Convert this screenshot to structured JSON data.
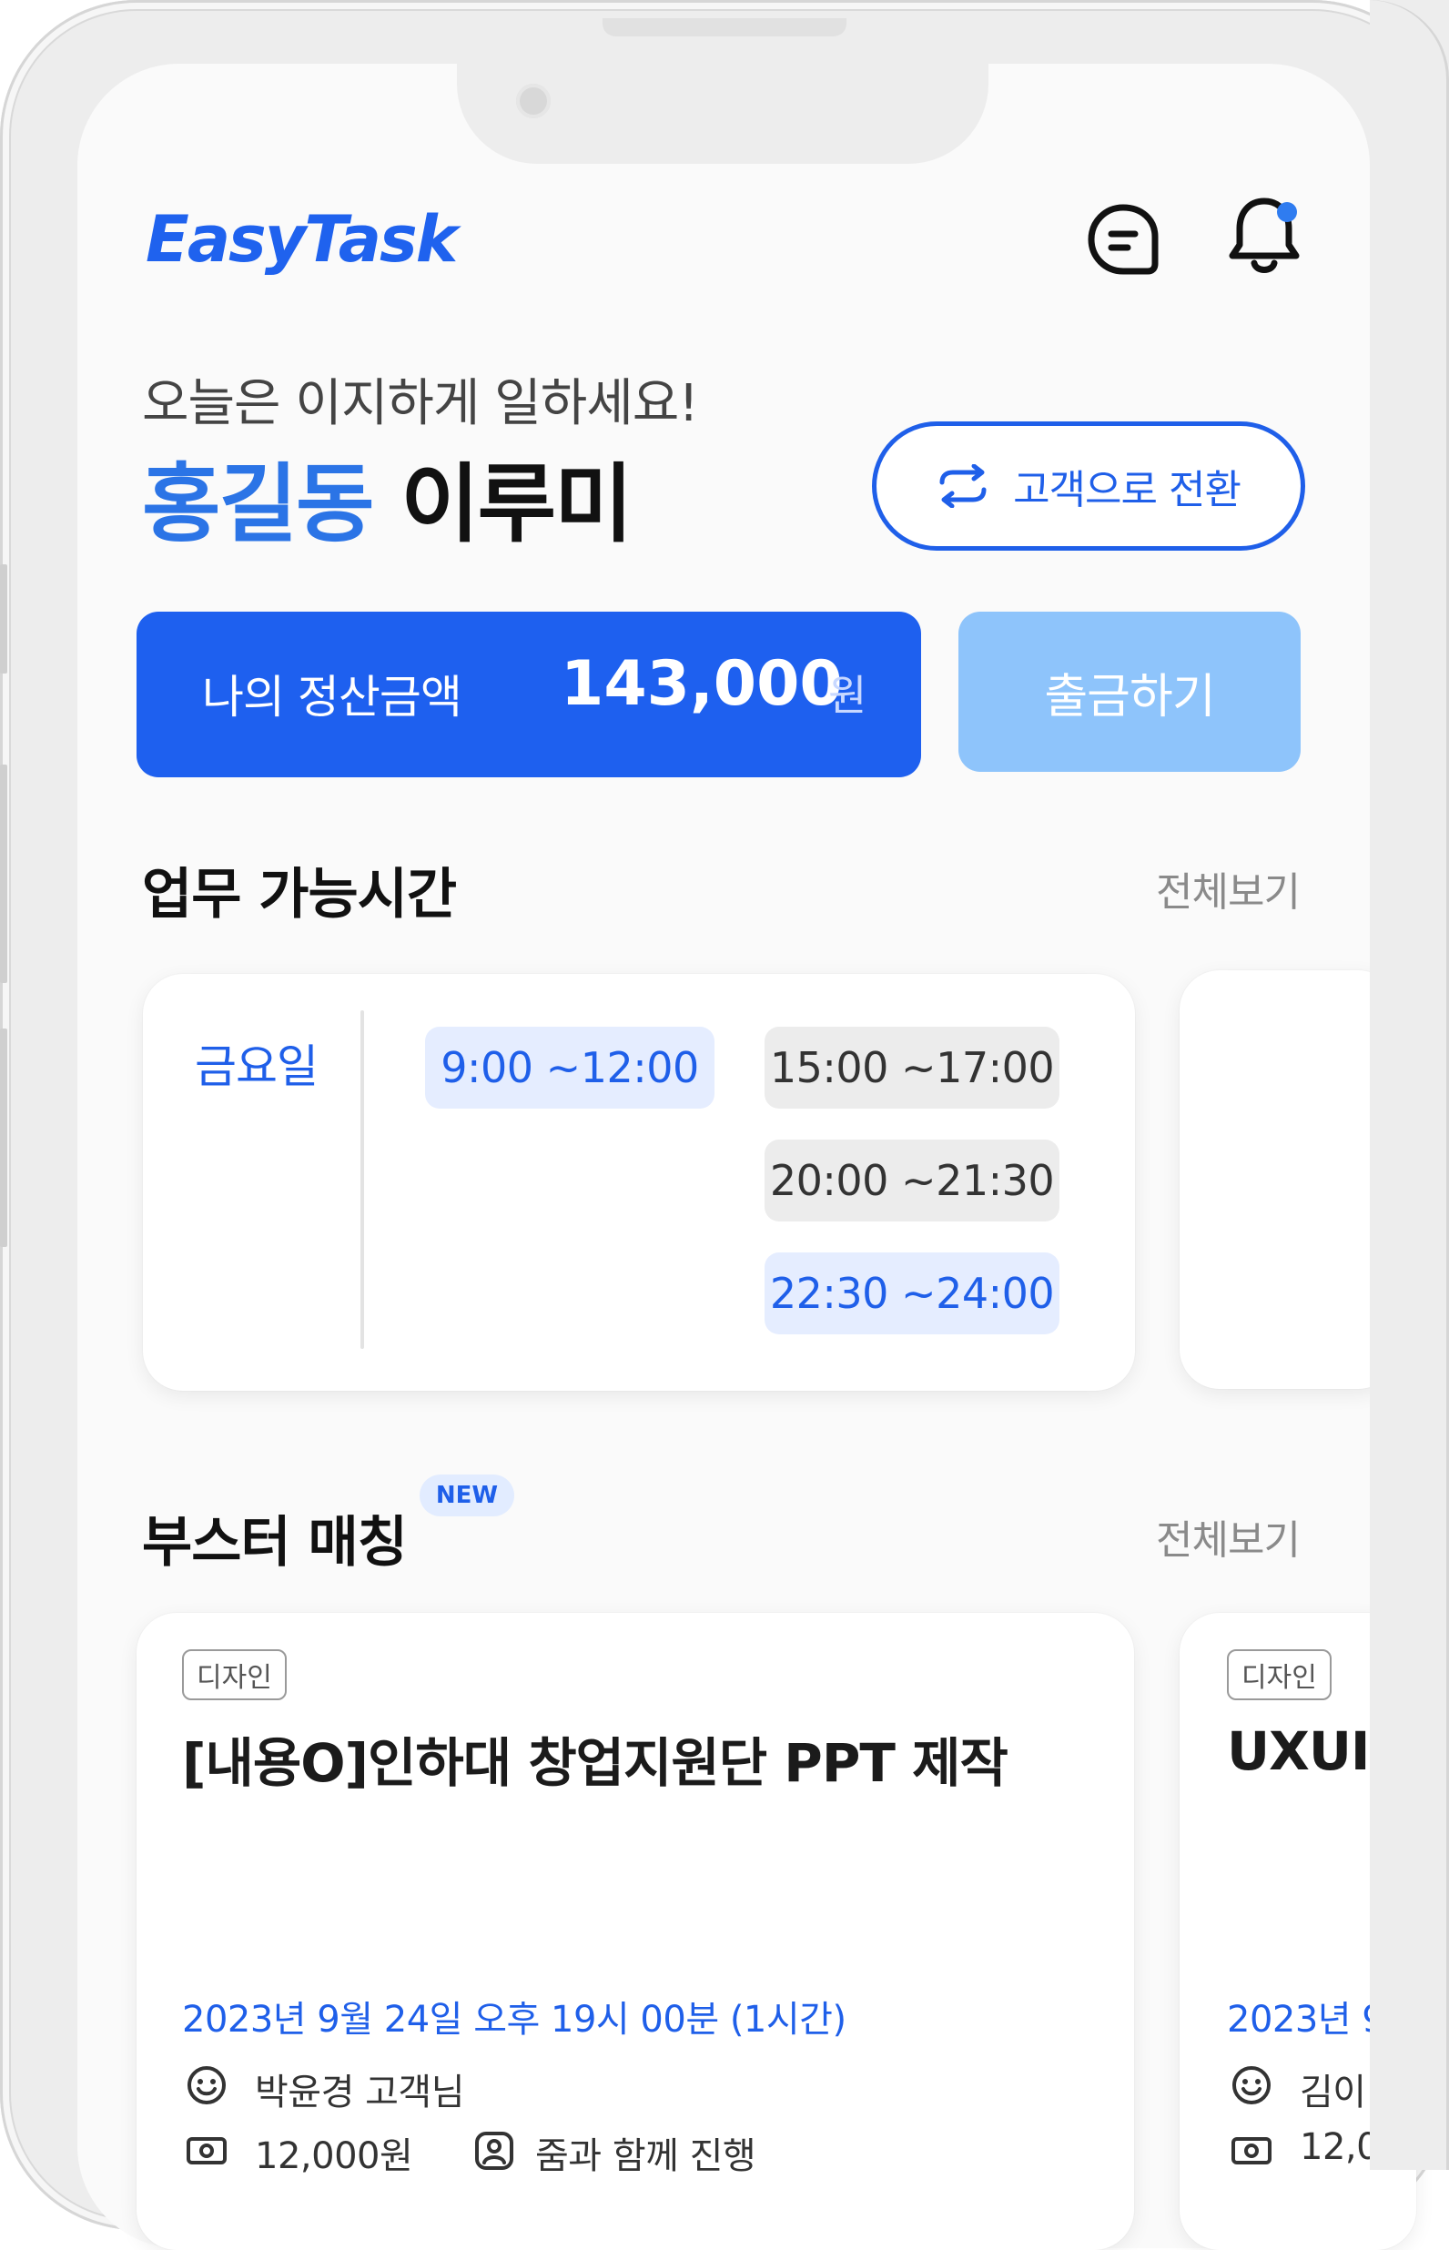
{
  "app": {
    "logo": "EasyTask"
  },
  "header": {
    "greeting": "오늘은 이지하게 일하세요!",
    "name_brand": "홍길동",
    "name_person": "이루미",
    "switch_label": "고객으로 전환"
  },
  "balance": {
    "label": "나의 정산금액",
    "amount": "143,000",
    "unit": "원",
    "withdraw_label": "출금하기"
  },
  "availability": {
    "title": "업무 가능시간",
    "view_all": "전체보기",
    "day": "금요일",
    "slots": [
      {
        "time": "9:00 ~12:00",
        "state": "selected"
      },
      {
        "time": "15:00 ~17:00",
        "state": "default"
      },
      {
        "time": "20:00 ~21:30",
        "state": "default"
      },
      {
        "time": "22:30 ~24:00",
        "state": "selected"
      }
    ]
  },
  "booster": {
    "title": "부스터 매칭",
    "badge": "NEW",
    "view_all": "전체보기",
    "cards": [
      {
        "category": "디자인",
        "title": "[내용O]인하대 창업지원단 PPT 제작",
        "datetime": "2023년 9월 24일 오후 19시 00분 (1시간)",
        "client": "박윤경 고객님",
        "price": "12,000원",
        "mode": "줌과 함께 진행"
      },
      {
        "category": "디자인",
        "title": "UXUI",
        "datetime": "2023년 9",
        "client": "김이",
        "price": "12,0"
      }
    ]
  },
  "colors": {
    "brand": "#1f5fe9",
    "withdraw": "#8ec4fb",
    "notification_dot": "#2f7cf0"
  },
  "icons": [
    "chat-icon",
    "bell-icon",
    "swap-arrows-icon",
    "smiley-icon",
    "money-icon",
    "person-icon"
  ]
}
